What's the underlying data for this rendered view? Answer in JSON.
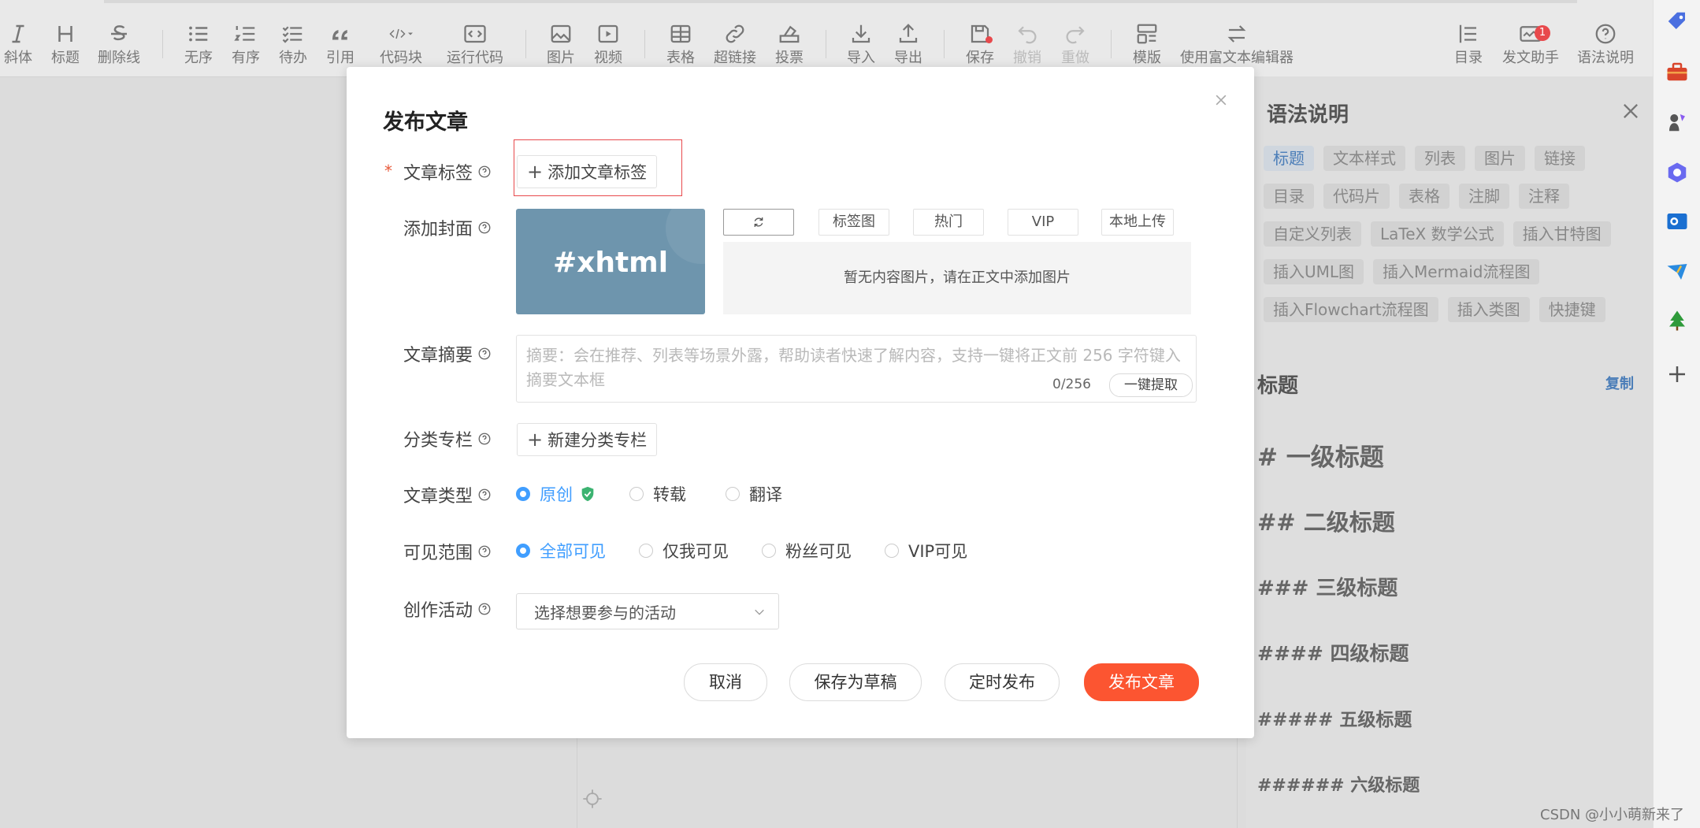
{
  "toolbar": {
    "items": [
      {
        "label": "斜体",
        "icon": "italic-icon"
      },
      {
        "label": "标题",
        "icon": "heading-icon"
      },
      {
        "label": "删除线",
        "icon": "strikethrough-icon"
      },
      {
        "label": "无序",
        "icon": "unordered-list-icon"
      },
      {
        "label": "有序",
        "icon": "ordered-list-icon"
      },
      {
        "label": "待办",
        "icon": "todo-list-icon"
      },
      {
        "label": "引用",
        "icon": "quote-icon"
      },
      {
        "label": "代码块",
        "icon": "code-block-icon"
      },
      {
        "label": "运行代码",
        "icon": "run-code-icon"
      },
      {
        "label": "图片",
        "icon": "image-icon"
      },
      {
        "label": "视频",
        "icon": "video-icon"
      },
      {
        "label": "表格",
        "icon": "table-icon"
      },
      {
        "label": "超链接",
        "icon": "link-icon"
      },
      {
        "label": "投票",
        "icon": "vote-icon"
      },
      {
        "label": "导入",
        "icon": "import-icon"
      },
      {
        "label": "导出",
        "icon": "export-icon"
      },
      {
        "label": "保存",
        "icon": "save-icon"
      },
      {
        "label": "撤销",
        "icon": "undo-icon"
      },
      {
        "label": "重做",
        "icon": "redo-icon"
      },
      {
        "label": "模版",
        "icon": "template-icon"
      },
      {
        "label": "使用富文本编辑器",
        "icon": "switch-editor-icon"
      },
      {
        "label": "目录",
        "icon": "toc-icon"
      },
      {
        "label": "发文助手",
        "icon": "assistant-icon"
      },
      {
        "label": "语法说明",
        "icon": "help-icon"
      }
    ],
    "assistant_badge": "1"
  },
  "syntax_panel": {
    "title": "语法说明",
    "chips": [
      "标题",
      "文本样式",
      "列表",
      "图片",
      "链接",
      "目录",
      "代码片",
      "表格",
      "注脚",
      "注释",
      "自定义列表",
      "LaTeX 数学公式",
      "插入甘特图",
      "插入UML图",
      "插入Mermaid流程图",
      "插入Flowchart流程图",
      "插入类图",
      "快捷键"
    ],
    "section_title": "标题",
    "copy_label": "复制",
    "headings": [
      "# 一级标题",
      "## 二级标题",
      "### 三级标题",
      "#### 四级标题",
      "##### 五级标题",
      "###### 六级标题"
    ]
  },
  "modal": {
    "title": "发布文章",
    "required_mark": "*",
    "labels": {
      "tags": "文章标签",
      "cover": "添加封面",
      "summary": "文章摘要",
      "column": "分类专栏",
      "type": "文章类型",
      "visibility": "可见范围",
      "activity": "创作活动"
    },
    "add_tag_button": "添加文章标签",
    "cover_text": "#xhtml",
    "cover_options": [
      "标签图",
      "热门",
      "VIP",
      "本地上传"
    ],
    "cover_placeholder": "暂无内容图片，请在正文中添加图片",
    "summary_placeholder": "摘要：会在推荐、列表等场景外露，帮助读者快速了解内容，支持一键将正文前 256 字符键入摘要文本框",
    "summary_count": "0/256",
    "extract_button": "一键提取",
    "new_column_button": "新建分类专栏",
    "article_types": [
      "原创",
      "转载",
      "翻译"
    ],
    "visibility_options": [
      "全部可见",
      "仅我可见",
      "粉丝可见",
      "VIP可见"
    ],
    "activity_placeholder": "选择想要参与的活动",
    "footer": {
      "cancel": "取消",
      "save_draft": "保存为草稿",
      "schedule": "定时发布",
      "publish": "发布文章"
    }
  },
  "watermark": "CSDN @小小萌新来了"
}
